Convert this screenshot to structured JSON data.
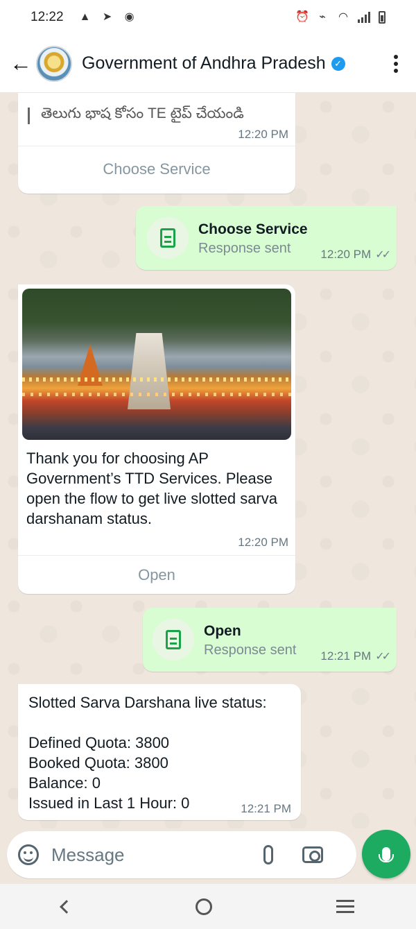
{
  "status_bar": {
    "time": "12:22"
  },
  "header": {
    "title": "Government of Andhra Pradesh",
    "verified_icon": "verified-badge-icon"
  },
  "messages": [
    {
      "direction": "incoming",
      "text": "తెలుగు భాష కోసం TE టైప్ చేయండి",
      "time": "12:20 PM",
      "button_label": "Choose Service"
    },
    {
      "direction": "outgoing",
      "title": "Choose Service",
      "subtitle": "Response sent",
      "time": "12:20 PM"
    },
    {
      "direction": "incoming",
      "image": "temple-photo",
      "text": "Thank you for choosing AP Government’s TTD Services. Please open the flow to get live slotted sarva darshanam status.",
      "time": "12:20 PM",
      "button_label": "Open"
    },
    {
      "direction": "outgoing",
      "title": "Open",
      "subtitle": "Response sent",
      "time": "12:21 PM"
    },
    {
      "direction": "incoming",
      "heading": "Slotted Sarva Darshana live status:",
      "lines": [
        "Defined Quota: 3800",
        "Booked Quota: 3800",
        "Balance: 0",
        "Issued in Last 1 Hour: 0"
      ],
      "time": "12:21 PM"
    }
  ],
  "composer": {
    "placeholder": "Message"
  },
  "colors": {
    "incoming_bubble": "#ffffff",
    "outgoing_bubble": "#d9fdd3",
    "send_button": "#1daa61",
    "chat_background": "#efe7dd"
  }
}
